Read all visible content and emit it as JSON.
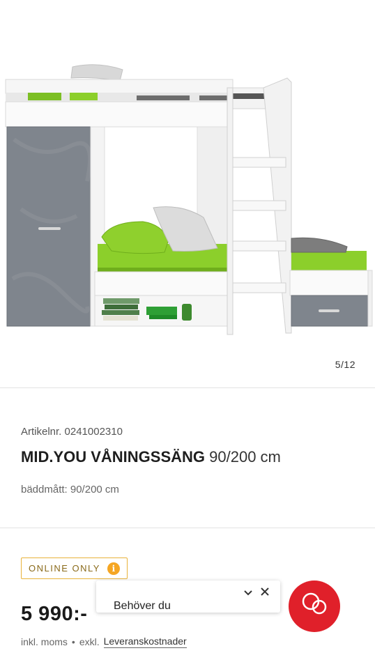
{
  "gallery": {
    "image_alt": "Våningssäng med garderob",
    "counter": "5/12"
  },
  "product": {
    "sku": "Artikelnr. 0241002310",
    "brand_name": "MID.YOU VÅNINGSSÄNG",
    "size": "90/200 cm",
    "bed_size": "bäddmått: 90/200 cm"
  },
  "badge": {
    "label": "ONLINE ONLY",
    "icon": "info-icon"
  },
  "price": {
    "amount": "5 990:-",
    "incl": "inkl. moms",
    "separator": "•",
    "excl": "exkl.",
    "delivery_link": "Leveranskostnader"
  },
  "chat": {
    "prompt": "Behöver du",
    "minimize_icon": "chevron-down-icon",
    "close_icon": "close-icon",
    "fab_icon": "chat-bubbles-icon"
  },
  "colors": {
    "accent_red": "#e0202a",
    "badge_border": "#e8b23a",
    "badge_icon": "#f5a623",
    "mattress_green": "#8ccf2b",
    "wood_grey": "#7f858d"
  }
}
